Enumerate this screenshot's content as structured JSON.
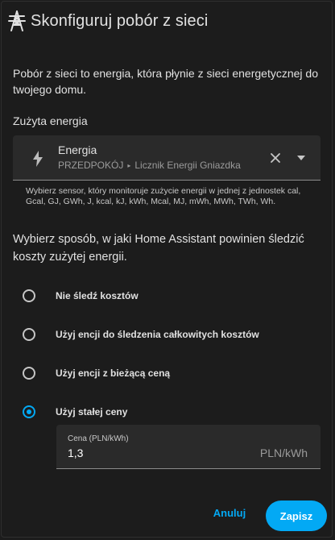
{
  "dialog": {
    "title": "Skonfiguruj pobór z sieci",
    "icon": "transmission-tower-icon",
    "intro": "Pobór z sieci to energia, która płynie z sieci energetycznej do twojego domu.",
    "section_label": "Zużyta energia",
    "entity_picker": {
      "icon": "lightning-bolt-icon",
      "name": "Energia",
      "area": "PRZEDPOKÓJ",
      "separator": "▸",
      "device": "Licznik Energii Gniazdka"
    },
    "helper": "Wybierz sensor, który monitoruje zużycie energii w jednej z jednostek cal, Gcal, GJ, GWh, J, kcal, kJ, kWh, Mcal, MJ, mWh, MWh, TWh, Wh.",
    "question": "Wybierz sposób, w jaki Home Assistant powinien śledzić koszty zużytej energii.",
    "options": [
      {
        "label": "Nie śledź kosztów",
        "checked": false
      },
      {
        "label": "Użyj encji do śledzenia całkowitych kosztów",
        "checked": false
      },
      {
        "label": "Użyj encji z bieżącą ceną",
        "checked": false
      },
      {
        "label": "Użyj stałej ceny",
        "checked": true
      }
    ],
    "price": {
      "label": "Cena (PLN/kWh)",
      "value": "1,3",
      "suffix": "PLN/kWh"
    },
    "cancel_label": "Anuluj",
    "save_label": "Zapisz"
  },
  "colors": {
    "background": "#1c1c1c",
    "field_background": "#2a2a2a",
    "accent": "#03a9f4",
    "text": "#e1e1e1",
    "secondary_text": "#9b9b9b"
  }
}
